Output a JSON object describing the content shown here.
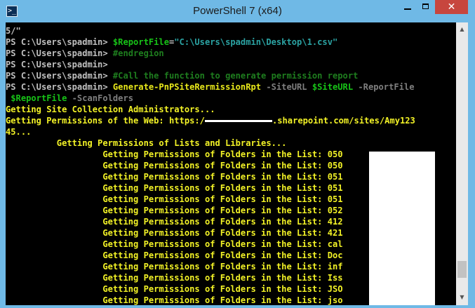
{
  "window": {
    "title": "PowerShell 7 (x64)",
    "icon_label": ">_",
    "buttons": {
      "close_glyph": "✕"
    }
  },
  "console": {
    "line0": {
      "text": "5/\""
    },
    "line1": {
      "prompt": "PS C:\\Users\\spadmin> ",
      "var": "$ReportFile",
      "op": "=",
      "str": "\"C:\\Users\\spadmin\\Desktop\\1.csv\""
    },
    "line2": {
      "prompt": "PS C:\\Users\\spadmin> ",
      "comment": "#endregion"
    },
    "line3": {
      "prompt": "PS C:\\Users\\spadmin>"
    },
    "line4": {
      "prompt": "PS C:\\Users\\spadmin> ",
      "comment": "#Call the function to generate permission report"
    },
    "line5": {
      "prompt": "PS C:\\Users\\spadmin> ",
      "cmd": "Generate-PnPSiteRermissionRpt",
      "param1": " -SiteURL ",
      "var1": "$SiteURL",
      "param2": " -ReportFile"
    },
    "line6": {
      "indent": " ",
      "var": "$ReportFile",
      "param": " -ScanFolders"
    },
    "line7": {
      "text": "Getting Site Collection Administrators..."
    },
    "line8": {
      "prefix": "Getting Permissions of the Web: https:/",
      "suffix": ".sharepoint.com/sites/Amy123"
    },
    "line9": {
      "text": "45..."
    },
    "line10": {
      "text": "          Getting Permissions of Lists and Libraries..."
    },
    "folder_prefix": "                   Getting Permissions of Folders in the List: ",
    "folder_lists": [
      "050",
      "050",
      "051",
      "051",
      "051",
      "052",
      "412",
      "421",
      "cal",
      "Doc",
      "inf",
      "Iss",
      "JSO",
      "jso"
    ]
  },
  "colors": {
    "console_bg": "#000000",
    "prompt": "#c0c0c0",
    "variable": "#17c317",
    "string": "#2ba3a3",
    "comment": "#1e7d1e",
    "command": "#e8e81a",
    "parameter": "#7f7f7f",
    "output": "#f2f226",
    "chrome": "#6fb9e6",
    "close_button": "#c7463e"
  },
  "scrollbar": {
    "up_icon": "▲",
    "down_icon": "▼"
  }
}
